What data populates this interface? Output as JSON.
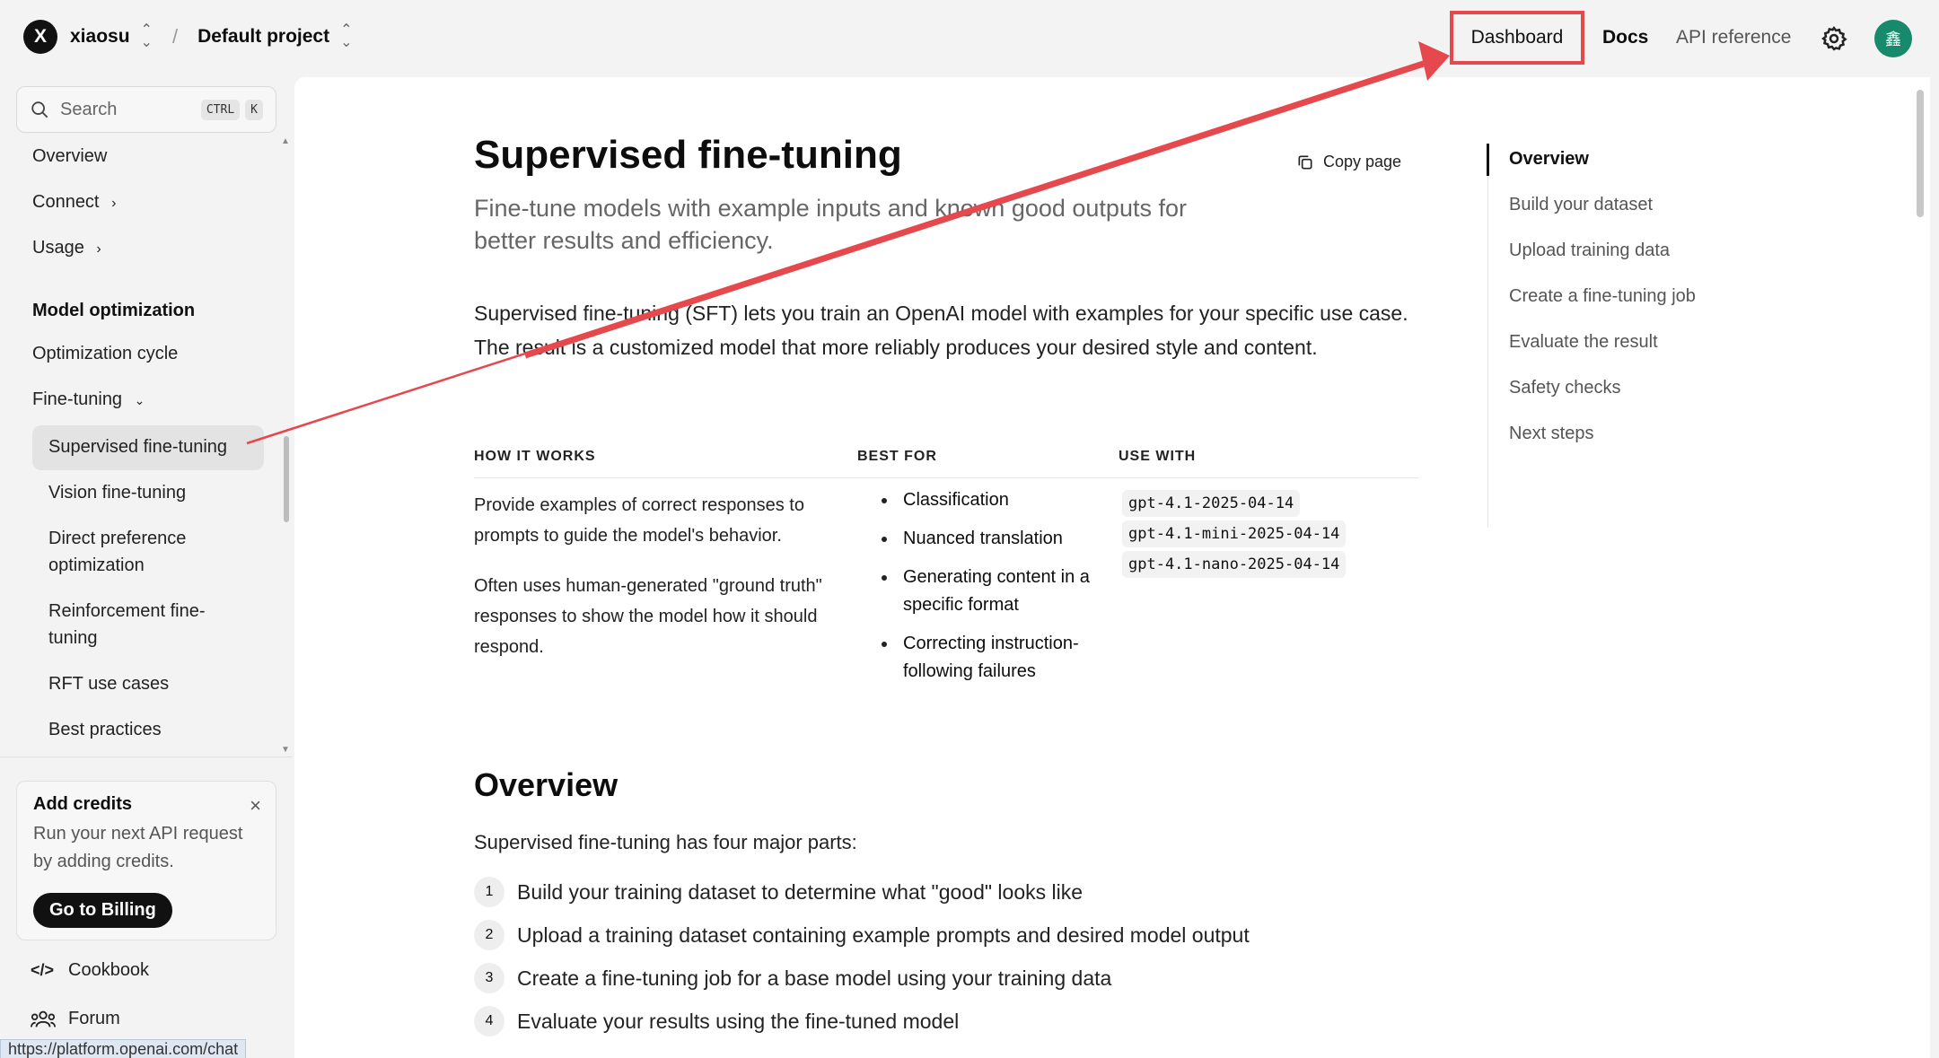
{
  "topbar": {
    "org_badge": "X",
    "org_name": "xiaosu",
    "project": "Default project",
    "nav": {
      "dashboard": "Dashboard",
      "docs": "Docs",
      "api": "API reference"
    },
    "avatar_initial": "鑫"
  },
  "sidebar": {
    "search": {
      "placeholder": "Search",
      "kbd_ctrl": "CTRL",
      "kbd_k": "K"
    },
    "items_top": [
      "Overview",
      "Connect",
      "Usage"
    ],
    "section_heading": "Model optimization",
    "optimization_cycle": "Optimization cycle",
    "fine_tuning": "Fine-tuning",
    "sub_items": [
      "Supervised fine-tuning",
      "Vision fine-tuning",
      "Direct preference optimization",
      "Reinforcement fine-tuning",
      "RFT use cases",
      "Best practices"
    ],
    "credits": {
      "title": "Add credits",
      "text": "Run your next API request by adding credits.",
      "button": "Go to Billing"
    },
    "cookbook": "Cookbook",
    "forum": "Forum",
    "status_url": "https://platform.openai.com/chat"
  },
  "main": {
    "title": "Supervised fine-tuning",
    "copy_page": "Copy page",
    "subtitle": "Fine-tune models with example inputs and known good outputs for better results and efficiency.",
    "intro": "Supervised fine-tuning (SFT) lets you train an OpenAI model with examples for your specific use case. The result is a customized model that more reliably produces your desired style and content.",
    "table": {
      "headers": [
        "HOW IT WORKS",
        "BEST FOR",
        "USE WITH"
      ],
      "how_it_works": [
        "Provide examples of correct responses to prompts to guide the model's behavior.",
        "Often uses human-generated \"ground truth\" responses to show the model how it should respond."
      ],
      "best_for": [
        "Classification",
        "Nuanced translation",
        "Generating content in a specific format",
        "Correcting instruction-following failures"
      ],
      "use_with": [
        "gpt-4.1-2025-04-14",
        "gpt-4.1-mini-2025-04-14",
        "gpt-4.1-nano-2025-04-14"
      ]
    },
    "overview_heading": "Overview",
    "overview_text": "Supervised fine-tuning has four major parts:",
    "steps": [
      {
        "num": "1",
        "text": "Build your training dataset to determine what \"good\" looks like"
      },
      {
        "num": "2",
        "text": "Upload a training dataset containing example prompts and desired model output"
      },
      {
        "num": "3",
        "text": "Create a fine-tuning job for a base model using your training data"
      },
      {
        "num": "4",
        "text": "Evaluate your results using the fine-tuned model"
      }
    ]
  },
  "toc": [
    "Overview",
    "Build your dataset",
    "Upload training data",
    "Create a fine-tuning job",
    "Evaluate the result",
    "Safety checks",
    "Next steps"
  ],
  "colors": {
    "annotation": "#e5484d",
    "avatar": "#178a6b"
  }
}
